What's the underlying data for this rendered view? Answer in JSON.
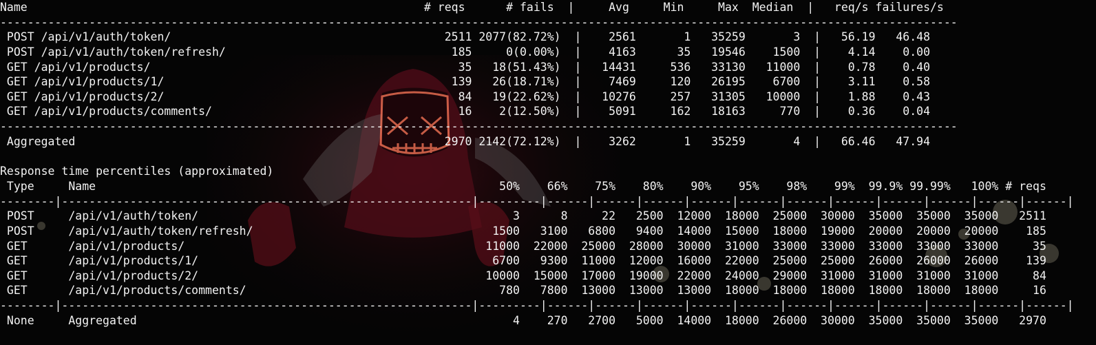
{
  "stats": {
    "header": "Name                                                          # reqs      # fails  |     Avg     Min     Max  Median  |   req/s failures/s",
    "sep": "--------------------------------------------------------------------------------------------------------------------------------------------",
    "rows": [
      " POST /api/v1/auth/token/                                        2511 2077(82.72%)  |    2561       1   35259       3  |   56.19   46.48",
      " POST /api/v1/auth/token/refresh/                                 185     0(0.00%)  |    4163      35   19546    1500  |    4.14    0.00",
      " GET /api/v1/products/                                             35   18(51.43%)  |   14431     536   33130   11000  |    0.78    0.40",
      " GET /api/v1/products/1/                                          139   26(18.71%)  |    7469     120   26195    6700  |    3.11    0.58",
      " GET /api/v1/products/2/                                           84   19(22.62%)  |   10276     257   31305   10000  |    1.88    0.43",
      " GET /api/v1/products/comments/                                    16    2(12.50%)  |    5091     162   18163     770  |    0.36    0.04"
    ],
    "aggregated": " Aggregated                                                      2970 2142(72.12%)  |    3262       1   35259       4  |   66.46   47.94"
  },
  "percentiles": {
    "title": "Response time percentiles (approximated)",
    "header": " Type     Name                                                           50%    66%    75%    80%    90%    95%    98%    99%  99.9% 99.99%   100% # reqs",
    "sep": "--------|------------------------------------------------------------|---------|------|------|------|------|------|------|------|------|------|------|------|",
    "rows": [
      " POST     /api/v1/auth/token/                                              3      8     22   2500  12000  18000  25000  30000  35000  35000  35000   2511",
      " POST     /api/v1/auth/token/refresh/                                   1500   3100   6800   9400  14000  15000  18000  19000  20000  20000  20000    185",
      " GET      /api/v1/products/                                            11000  22000  25000  28000  30000  31000  33000  33000  33000  33000  33000     35",
      " GET      /api/v1/products/1/                                           6700   9300  11000  12000  16000  22000  25000  25000  26000  26000  26000    139",
      " GET      /api/v1/products/2/                                          10000  15000  17000  19000  22000  24000  29000  31000  31000  31000  31000     84",
      " GET      /api/v1/products/comments/                                     780   7800  13000  13000  13000  18000  18000  18000  18000  18000  18000     16"
    ],
    "aggregated": " None     Aggregated                                                       4    270   2700   5000  14000  18000  26000  30000  35000  35000  35000   2970"
  }
}
